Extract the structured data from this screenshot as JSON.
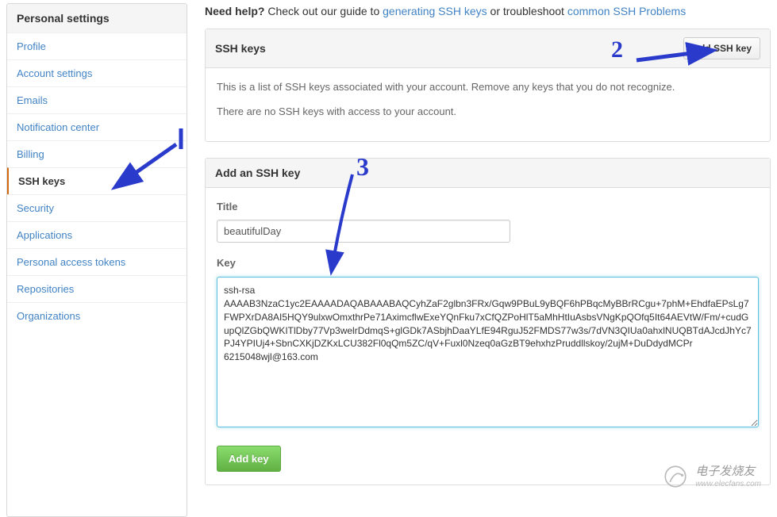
{
  "sidebar": {
    "header": "Personal settings",
    "items": [
      {
        "label": "Profile"
      },
      {
        "label": "Account settings"
      },
      {
        "label": "Emails"
      },
      {
        "label": "Notification center"
      },
      {
        "label": "Billing"
      },
      {
        "label": "SSH keys"
      },
      {
        "label": "Security"
      },
      {
        "label": "Applications"
      },
      {
        "label": "Personal access tokens"
      },
      {
        "label": "Repositories"
      },
      {
        "label": "Organizations"
      }
    ]
  },
  "help": {
    "prefix_bold": "Need help?",
    "middle": " Check out our guide to ",
    "link1": "generating SSH keys",
    "middle2": " or troubleshoot ",
    "link2": "common SSH Problems"
  },
  "ssh_list": {
    "header": "SSH keys",
    "add_button": "Add SSH key",
    "desc1": "This is a list of SSH keys associated with your account. Remove any keys that you do not recognize.",
    "desc2": "There are no SSH keys with access to your account."
  },
  "add_form": {
    "header": "Add an SSH key",
    "title_label": "Title",
    "title_value": "beautifulDay",
    "key_label": "Key",
    "key_value": "ssh-rsa AAAAB3NzaC1yc2EAAAADAQABAAABAQCyhZaF2glbn3FRx/Gqw9PBuL9yBQF6hPBqcMyBBrRCgu+7phM+EhdfaEPsLg7FWPXrDA8AI5HQY9ulxwOmxthrPe71AximcflwExeYQnFku7xCfQZPoHlT5aMhHtIuAsbsVNgKpQOfq5It64AEVtW/Fm/+cudGupQlZGbQWKITlDby77Vp3welrDdmqS+glGDk7ASbjhDaaYLfE94RguJ52FMDS77w3s/7dVN3QIUa0ahxlNUQBTdAJcdJhYc7PJ4YPIUj4+SbnCXKjDZKxLCU382Fl0qQm5ZC/qV+Fuxl0Nzeq0aGzBT9ehxhzPruddllskoy/2ujM+DuDdydMCPr 6215048wjl@163.com",
    "submit": "Add key"
  },
  "annotations": {
    "num2": "2",
    "num3": "3"
  },
  "watermark": {
    "text": "电子发烧友",
    "sub": "www.elecfans.com"
  }
}
